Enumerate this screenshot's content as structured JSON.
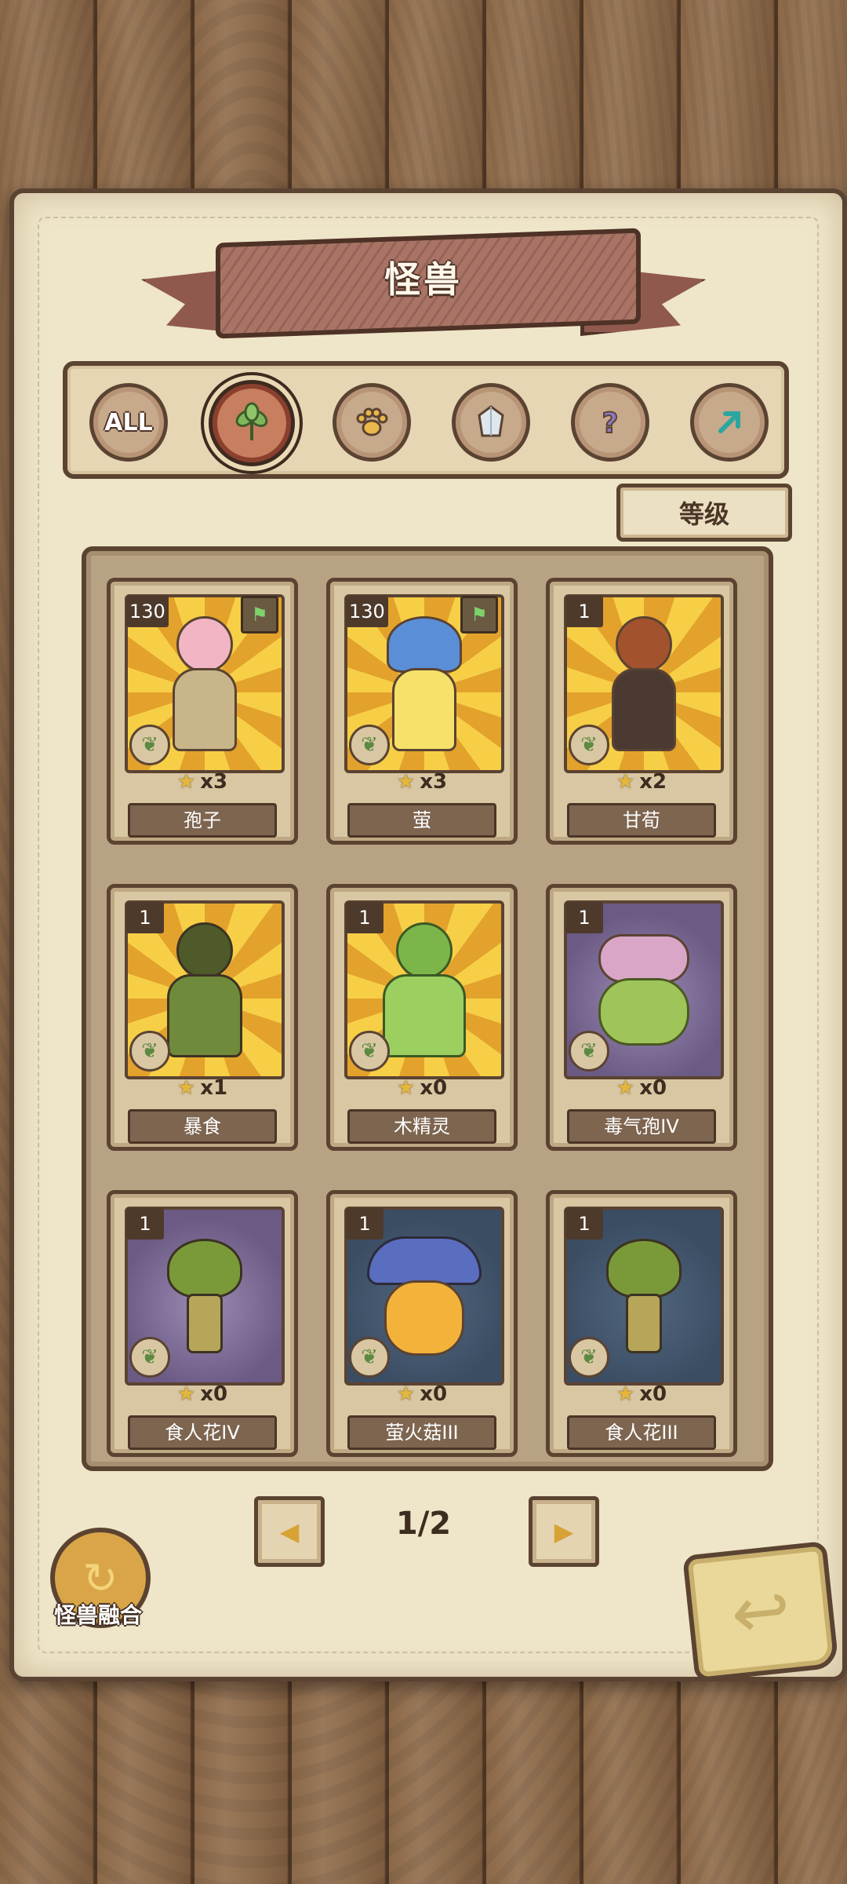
{
  "header": {
    "title": "怪兽"
  },
  "filters": [
    {
      "label": "ALL",
      "icon": "all-icon",
      "active": false
    },
    {
      "label": "",
      "icon": "leaf-icon",
      "active": true
    },
    {
      "label": "",
      "icon": "paw-icon",
      "active": false
    },
    {
      "label": "",
      "icon": "crystal-icon",
      "active": false
    },
    {
      "label": "",
      "icon": "question-icon",
      "active": false
    },
    {
      "label": "",
      "icon": "rune-icon",
      "active": false
    }
  ],
  "sort": {
    "label": "等级"
  },
  "cards": [
    {
      "name": "孢子",
      "level": "130",
      "count": "x3",
      "bg": "yellow",
      "flag": true
    },
    {
      "name": "萤",
      "level": "130",
      "count": "x3",
      "bg": "yellow",
      "flag": true
    },
    {
      "name": "甘荀",
      "level": "1",
      "count": "x2",
      "bg": "yellow",
      "flag": false
    },
    {
      "name": "暴食",
      "level": "1",
      "count": "x1",
      "bg": "yellow",
      "flag": false
    },
    {
      "name": "木精灵",
      "level": "1",
      "count": "x0",
      "bg": "yellow",
      "flag": false
    },
    {
      "name": "毒气孢IV",
      "level": "1",
      "count": "x0",
      "bg": "purple",
      "flag": false
    },
    {
      "name": "食人花IV",
      "level": "1",
      "count": "x0",
      "bg": "purple",
      "flag": false
    },
    {
      "name": "萤火菇III",
      "level": "1",
      "count": "x0",
      "bg": "blue",
      "flag": false
    },
    {
      "name": "食人花III",
      "level": "1",
      "count": "x0",
      "bg": "blue",
      "flag": false
    }
  ],
  "pager": {
    "page": "1/2"
  },
  "fusion": {
    "label": "怪兽融合"
  },
  "colors": {
    "accent": "#c77f5f",
    "star": "#e4b73a",
    "frame": "#5b4332"
  }
}
